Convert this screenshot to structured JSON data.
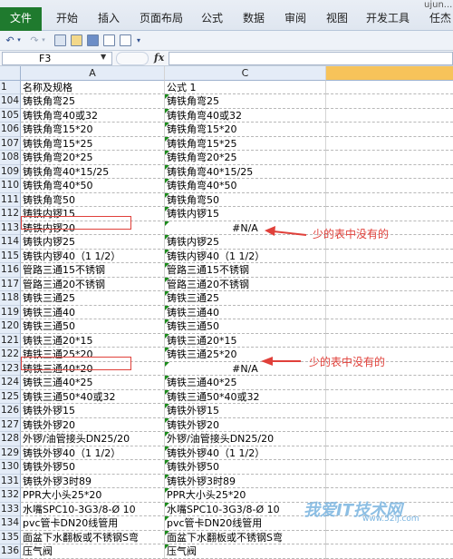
{
  "ribbon": {
    "file_tab": "文件",
    "tabs": [
      "开始",
      "插入",
      "页面布局",
      "公式",
      "数据",
      "审阅",
      "视图",
      "开发工具",
      "任杰"
    ],
    "title_fragment": "ujun..."
  },
  "formula_bar": {
    "name_box": "F3",
    "fx_label": "fx",
    "formula": ""
  },
  "sheet": {
    "columns": [
      "A",
      "C",
      ""
    ],
    "rows": [
      {
        "num": "1",
        "a": "名称及规格",
        "c": "公式 1"
      },
      {
        "num": "104",
        "a": "铸铁角弯25",
        "c": "铸铁角弯25"
      },
      {
        "num": "105",
        "a": "铸铁角弯40或32",
        "c": "铸铁角弯40或32"
      },
      {
        "num": "106",
        "a": "铸铁角弯15*20",
        "c": "铸铁角弯15*20"
      },
      {
        "num": "107",
        "a": "铸铁角弯15*25",
        "c": "铸铁角弯15*25"
      },
      {
        "num": "108",
        "a": "铸铁角弯20*25",
        "c": "铸铁角弯20*25"
      },
      {
        "num": "109",
        "a": "铸铁角弯40*15/25",
        "c": "铸铁角弯40*15/25"
      },
      {
        "num": "110",
        "a": "铸铁角弯40*50",
        "c": "铸铁角弯40*50"
      },
      {
        "num": "111",
        "a": "铸铁角弯50",
        "c": "铸铁角弯50"
      },
      {
        "num": "112",
        "a": "铸铁内锣15",
        "c": "铸铁内锣15"
      },
      {
        "num": "113",
        "a": "铸铁内锣20",
        "c": "#N/A"
      },
      {
        "num": "114",
        "a": "铸铁内锣25",
        "c": "铸铁内锣25"
      },
      {
        "num": "115",
        "a": "铸铁内锣40（1 1/2）",
        "c": "铸铁内锣40（1 1/2）"
      },
      {
        "num": "116",
        "a": "管路三通15不锈钢",
        "c": "管路三通15不锈钢"
      },
      {
        "num": "117",
        "a": "管路三通20不锈钢",
        "c": "管路三通20不锈钢"
      },
      {
        "num": "118",
        "a": "铸铁三通25",
        "c": "铸铁三通25"
      },
      {
        "num": "119",
        "a": "铸铁三通40",
        "c": "铸铁三通40"
      },
      {
        "num": "120",
        "a": "铸铁三通50",
        "c": "铸铁三通50"
      },
      {
        "num": "121",
        "a": "铸铁三通20*15",
        "c": "铸铁三通20*15"
      },
      {
        "num": "122",
        "a": "铸铁三通25*20",
        "c": "铸铁三通25*20"
      },
      {
        "num": "123",
        "a": "铸铁三通40*20",
        "c": "#N/A"
      },
      {
        "num": "124",
        "a": "铸铁三通40*25",
        "c": "铸铁三通40*25"
      },
      {
        "num": "125",
        "a": "铸铁三通50*40或32",
        "c": "铸铁三通50*40或32"
      },
      {
        "num": "126",
        "a": "铸铁外锣15",
        "c": "铸铁外锣15"
      },
      {
        "num": "127",
        "a": "铸铁外锣20",
        "c": "铸铁外锣20"
      },
      {
        "num": "128",
        "a": "外锣/油管接头DN25/20",
        "c": "外锣/油管接头DN25/20"
      },
      {
        "num": "129",
        "a": "铸铁外锣40（1 1/2）",
        "c": "铸铁外锣40（1 1/2）"
      },
      {
        "num": "130",
        "a": "铸铁外锣50",
        "c": "铸铁外锣50"
      },
      {
        "num": "131",
        "a": "铸铁外锣3时89",
        "c": "铸铁外锣3时89"
      },
      {
        "num": "132",
        "a": "PPR大小头25*20",
        "c": "PPR大小头25*20"
      },
      {
        "num": "133",
        "a": "水嘴SPC10-3G3/8-Ø 10",
        "c": "水嘴SPC10-3G3/8-Ø 10"
      },
      {
        "num": "134",
        "a": "pvc管卡DN20线管用",
        "c": "pvc管卡DN20线管用"
      },
      {
        "num": "135",
        "a": "面盆下水翻板或不锈钢S弯",
        "c": "面盆下水翻板或不锈钢S弯"
      },
      {
        "num": "136",
        "a": "压气阀",
        "c": "压气阀"
      }
    ]
  },
  "annotations": {
    "missing_1": "少的表中没有的",
    "missing_2": "少的表中没有的",
    "color": "#e0403a"
  },
  "watermark": {
    "main": "我爱IT技术网",
    "sub": "www.52ij.com"
  }
}
